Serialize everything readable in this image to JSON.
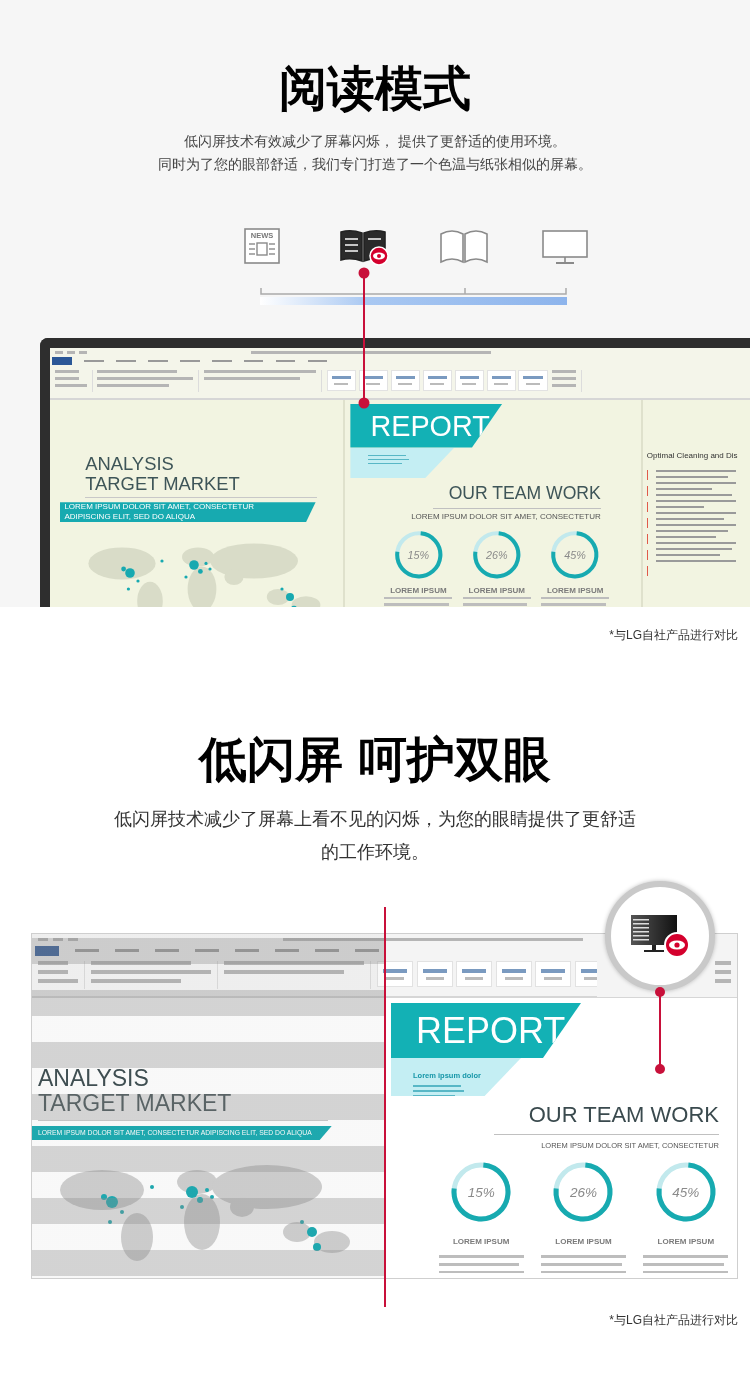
{
  "reading_mode": {
    "title": "阅读模式",
    "description": [
      "低闪屏技术有效减少了屏幕闪烁， 提供了更舒适的使用环境。",
      "同时为了您的眼部舒适，我们专门打造了一个色温与纸张相似的屏幕。"
    ],
    "modes": [
      {
        "kind": "newspaper",
        "label": "NEWS",
        "selected": false
      },
      {
        "kind": "ebook",
        "selected": true
      },
      {
        "kind": "book",
        "selected": false
      },
      {
        "kind": "monitor",
        "selected": false
      }
    ],
    "screen": {
      "kind": "monitor",
      "analysis": {
        "title_lines": [
          "ANALYSIS",
          "TARGET MARKET"
        ],
        "banner": "LOREM IPSUM DOLOR SIT AMET, CONSECTETUR ADIPISCING ELIT, SED DO ALIQUA"
      },
      "report": {
        "title": "REPORT",
        "heading": "OUR TEAM WORK",
        "subheading": "LOREM IPSUM DOLOR SIT AMET, CONSECTETUR",
        "stats": [
          {
            "value": "15%",
            "label": "LOREM IPSUM"
          },
          {
            "value": "26%",
            "label": "LOREM IPSUM"
          },
          {
            "value": "45%",
            "label": "LOREM IPSUM"
          }
        ]
      },
      "side_page": {
        "heading": "Optimal Cleaning and Dis"
      }
    },
    "footnote": "*与LG自社产品进行对比"
  },
  "low_flicker": {
    "title": "低闪屏 呵护双眼",
    "description": [
      "低闪屏技术减少了屏幕上看不见的闪烁，为您的眼睛提供了更舒适的工作环境。"
    ],
    "screen": {
      "kind": "flicker",
      "analysis": {
        "title_lines": [
          "ANALYSIS",
          "TARGET MARKET"
        ],
        "banner": "LOREM IPSUM DOLOR SIT AMET, CONSECTETUR ADIPISCING ELIT, SED DO ALIQUA"
      },
      "report": {
        "title": "REPORT",
        "note": "Lorem ipsum dolor",
        "heading": "OUR TEAM WORK",
        "subheading": "LOREM IPSUM DOLOR SIT AMET, CONSECTETUR",
        "stats": [
          {
            "value": "15%",
            "label": "LOREM IPSUM"
          },
          {
            "value": "26%",
            "label": "LOREM IPSUM"
          },
          {
            "value": "45%",
            "label": "LOREM IPSUM"
          }
        ]
      }
    },
    "footnote": "*与LG自社产品进行对比"
  }
}
